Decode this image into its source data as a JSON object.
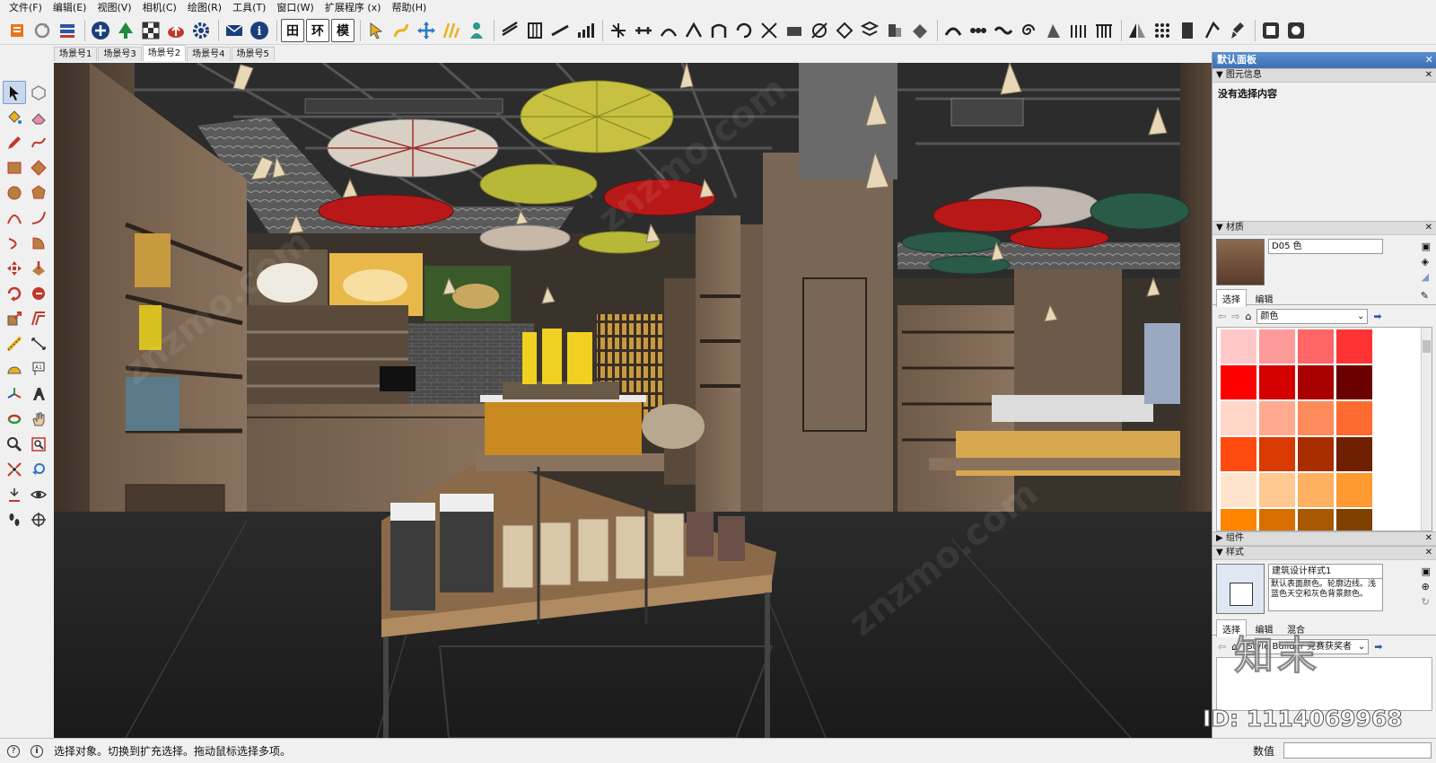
{
  "menu": [
    "文件(F)",
    "编辑(E)",
    "视图(V)",
    "相机(C)",
    "绘图(R)",
    "工具(T)",
    "窗口(W)",
    "扩展程序 (x)",
    "帮助(H)"
  ],
  "scene_tabs": [
    "场景号1",
    "场景号3",
    "场景号2",
    "场景号4",
    "场景号5"
  ],
  "active_scene_index": 2,
  "toolbar_text_icons": {
    "grid": "田",
    "env": "环",
    "model": "模"
  },
  "panel": {
    "title": "默认面板",
    "entity_info": {
      "header": "图元信息",
      "message": "没有选择内容"
    },
    "materials": {
      "header": "材质",
      "name": "D05 色",
      "tab_select": "选择",
      "tab_edit": "编辑",
      "library": "颜色",
      "swatches": [
        "#ffc8c8",
        "#ff9a9a",
        "#ff6666",
        "#ff3333",
        "#ff0000",
        "#d40000",
        "#a80000",
        "#6a0000",
        "#ffd6c8",
        "#ffaa90",
        "#ff8a5c",
        "#ff6a30",
        "#ff4a10",
        "#d83a00",
        "#a82e00",
        "#702000",
        "#ffe4cc",
        "#ffc890",
        "#ffb060",
        "#ff9a30",
        "#ff8400",
        "#d86e00",
        "#a85800",
        "#804000"
      ]
    },
    "components": {
      "header": "组件"
    },
    "styles": {
      "header": "样式",
      "name": "建筑设计样式1",
      "description": "默认表面颜色。轮廓边线。浅蓝色天空和灰色背景颜色。",
      "tab_select": "选择",
      "tab_edit": "编辑",
      "tab_mix": "混合",
      "library": "Style Builder 竞赛获奖者"
    }
  },
  "status": {
    "message": "选择对象。切换到扩充选择。拖动鼠标选择多项。",
    "measure_label": "数值",
    "measure_value": ""
  },
  "watermark": {
    "brand": "知末",
    "id": "ID: 1114069968"
  }
}
